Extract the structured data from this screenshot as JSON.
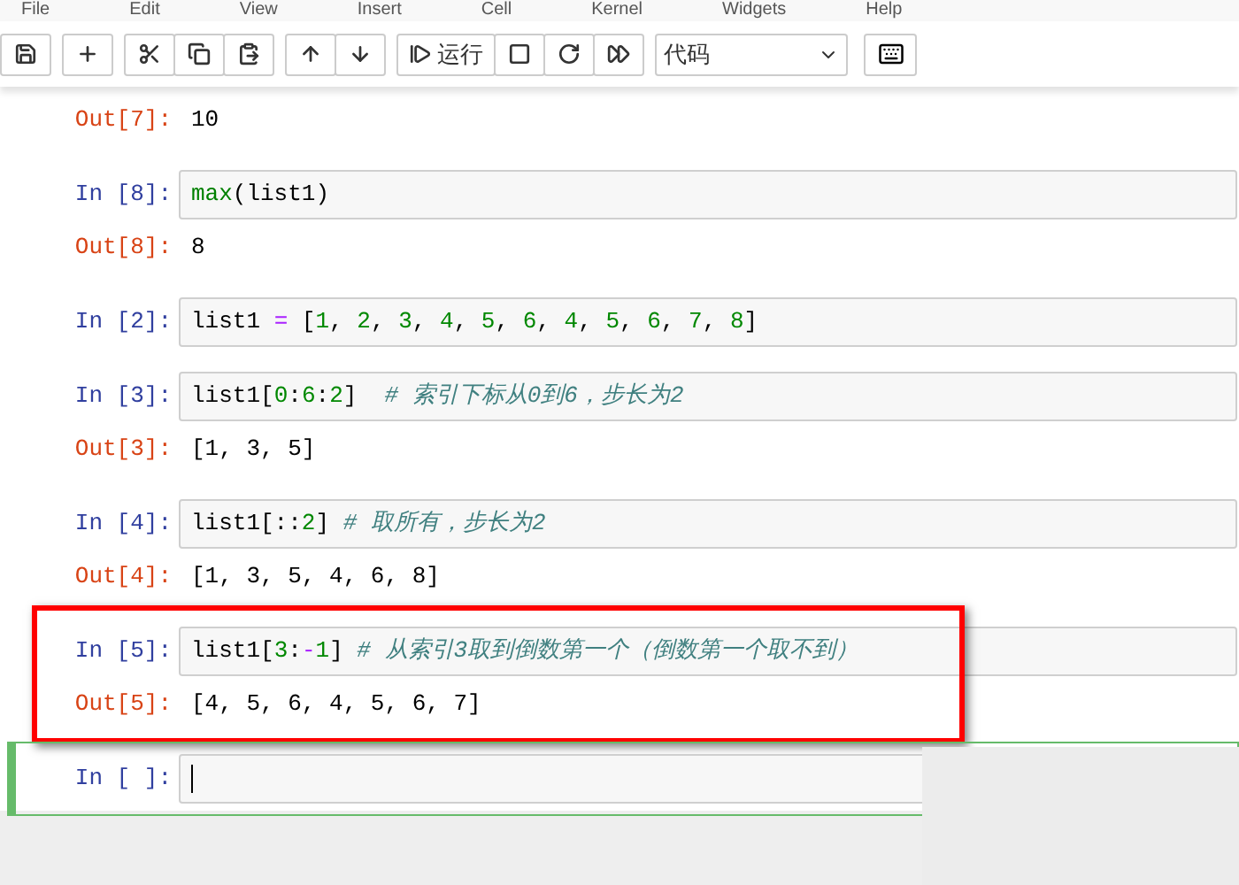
{
  "menu": [
    "File",
    "Edit",
    "View",
    "Insert",
    "Cell",
    "Kernel",
    "Widgets",
    "Help"
  ],
  "toolbar": [
    [
      {
        "kind": "save"
      }
    ],
    [
      {
        "kind": "insert"
      }
    ],
    [
      {
        "kind": "cut"
      },
      {
        "kind": "copy"
      },
      {
        "kind": "paste"
      }
    ],
    [
      {
        "kind": "up"
      },
      {
        "kind": "down"
      }
    ],
    [
      {
        "kind": "run",
        "label": "运行"
      },
      {
        "kind": "stop"
      },
      {
        "kind": "restart"
      },
      {
        "kind": "run-all"
      }
    ]
  ],
  "cell_type": {
    "value": "代码"
  },
  "cells": [
    {
      "output_prompt": "Out[7]:",
      "output": "10",
      "highlighted": false,
      "selected": false
    },
    {
      "prompt": "In [8]:",
      "code": [
        {
          "text": "max",
          "kind": "builtin"
        },
        {
          "text": "(list1)",
          "kind": "plain"
        }
      ],
      "output_prompt": "Out[8]:",
      "output": "8",
      "highlighted": false,
      "selected": false
    },
    {
      "prompt": "In [2]:",
      "code": [
        {
          "text": "list1 ",
          "kind": "plain"
        },
        {
          "text": "=",
          "kind": "op"
        },
        {
          "text": " [",
          "kind": "plain"
        },
        {
          "text": "1",
          "kind": "num"
        },
        {
          "text": ", ",
          "kind": "plain"
        },
        {
          "text": "2",
          "kind": "num"
        },
        {
          "text": ", ",
          "kind": "plain"
        },
        {
          "text": "3",
          "kind": "num"
        },
        {
          "text": ", ",
          "kind": "plain"
        },
        {
          "text": "4",
          "kind": "num"
        },
        {
          "text": ", ",
          "kind": "plain"
        },
        {
          "text": "5",
          "kind": "num"
        },
        {
          "text": ", ",
          "kind": "plain"
        },
        {
          "text": "6",
          "kind": "num"
        },
        {
          "text": ", ",
          "kind": "plain"
        },
        {
          "text": "4",
          "kind": "num"
        },
        {
          "text": ", ",
          "kind": "plain"
        },
        {
          "text": "5",
          "kind": "num"
        },
        {
          "text": ", ",
          "kind": "plain"
        },
        {
          "text": "6",
          "kind": "num"
        },
        {
          "text": ", ",
          "kind": "plain"
        },
        {
          "text": "7",
          "kind": "num"
        },
        {
          "text": ", ",
          "kind": "plain"
        },
        {
          "text": "8",
          "kind": "num"
        },
        {
          "text": "]",
          "kind": "plain"
        }
      ],
      "highlighted": false,
      "selected": false
    },
    {
      "prompt": "In [3]:",
      "code": [
        {
          "text": "list1[",
          "kind": "plain"
        },
        {
          "text": "0",
          "kind": "num"
        },
        {
          "text": ":",
          "kind": "plain"
        },
        {
          "text": "6",
          "kind": "num"
        },
        {
          "text": ":",
          "kind": "plain"
        },
        {
          "text": "2",
          "kind": "num"
        },
        {
          "text": "]  ",
          "kind": "plain"
        },
        {
          "text": "# 索引下标从0到6，步长为2",
          "kind": "comment"
        }
      ],
      "output_prompt": "Out[3]:",
      "output": "[1, 3, 5]",
      "highlighted": false,
      "selected": false
    },
    {
      "prompt": "In [4]:",
      "code": [
        {
          "text": "list1[::",
          "kind": "plain"
        },
        {
          "text": "2",
          "kind": "num"
        },
        {
          "text": "] ",
          "kind": "plain"
        },
        {
          "text": "# 取所有，步长为2",
          "kind": "comment"
        }
      ],
      "output_prompt": "Out[4]:",
      "output": "[1, 3, 5, 4, 6, 8]",
      "highlighted": false,
      "selected": false
    },
    {
      "prompt": "In [5]:",
      "code": [
        {
          "text": "list1[",
          "kind": "plain"
        },
        {
          "text": "3",
          "kind": "num"
        },
        {
          "text": ":",
          "kind": "plain"
        },
        {
          "text": "-",
          "kind": "op"
        },
        {
          "text": "1",
          "kind": "num"
        },
        {
          "text": "] ",
          "kind": "plain"
        },
        {
          "text": "# 从索引3取到倒数第一个（倒数第一个取不到）",
          "kind": "comment"
        }
      ],
      "output_prompt": "Out[5]:",
      "output": "[4, 5, 6, 4, 5, 6, 7]",
      "highlighted": true,
      "selected": false
    },
    {
      "prompt": "In [ ]:",
      "highlighted": false,
      "selected": true
    }
  ]
}
